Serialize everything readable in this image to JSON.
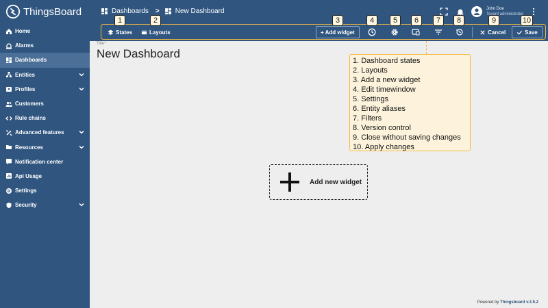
{
  "app": {
    "name": "ThingsBoard"
  },
  "sidebar": {
    "items": [
      {
        "label": "Home",
        "icon": "home-icon"
      },
      {
        "label": "Alarms",
        "icon": "alarm-icon"
      },
      {
        "label": "Dashboards",
        "icon": "dashboard-icon",
        "active": true
      },
      {
        "label": "Entities",
        "icon": "entities-icon",
        "expandable": true
      },
      {
        "label": "Profiles",
        "icon": "profiles-icon",
        "expandable": true
      },
      {
        "label": "Customers",
        "icon": "customers-icon"
      },
      {
        "label": "Rule chains",
        "icon": "rule-chains-icon"
      },
      {
        "label": "Advanced features",
        "icon": "tools-icon",
        "expandable": true
      },
      {
        "label": "Resources",
        "icon": "folder-icon",
        "expandable": true
      },
      {
        "label": "Notification center",
        "icon": "notification-icon"
      },
      {
        "label": "Api Usage",
        "icon": "api-usage-icon"
      },
      {
        "label": "Settings",
        "icon": "gear-icon"
      },
      {
        "label": "Security",
        "icon": "shield-icon",
        "expandable": true
      }
    ]
  },
  "header": {
    "breadcrumb": {
      "parent": "Dashboards",
      "separator": ">",
      "current": "New Dashboard"
    },
    "user": {
      "name": "John Doe",
      "role": "Tenant administrator"
    }
  },
  "toolbar": {
    "states_label": "States",
    "layouts_label": "Layouts",
    "add_widget_label": "+ Add widget",
    "cancel_label": "Cancel",
    "save_label": "Save",
    "markers": [
      "1",
      "2",
      "3",
      "4",
      "5",
      "6",
      "7",
      "8",
      "9",
      "10"
    ]
  },
  "main": {
    "title_label": "Title*",
    "title": "New Dashboard",
    "add_widget_prompt": "Add new widget"
  },
  "legend": {
    "items": [
      "1. Dashboard states",
      "2. Layouts",
      "3. Add a new widget",
      "4. Edit timewindow",
      "5. Settings",
      "6. Entity aliases",
      "7. Filters",
      "8. Version control",
      "9. Close without saving changes",
      "10. Apply changes"
    ]
  },
  "footer": {
    "prefix": "Powered by",
    "brand": "Thingsboard v.3.5.2"
  },
  "colors": {
    "primary": "#305680",
    "active_nav": "#4b6f97",
    "highlight": "#f4b941",
    "legend_bg": "#fdf3dc"
  }
}
